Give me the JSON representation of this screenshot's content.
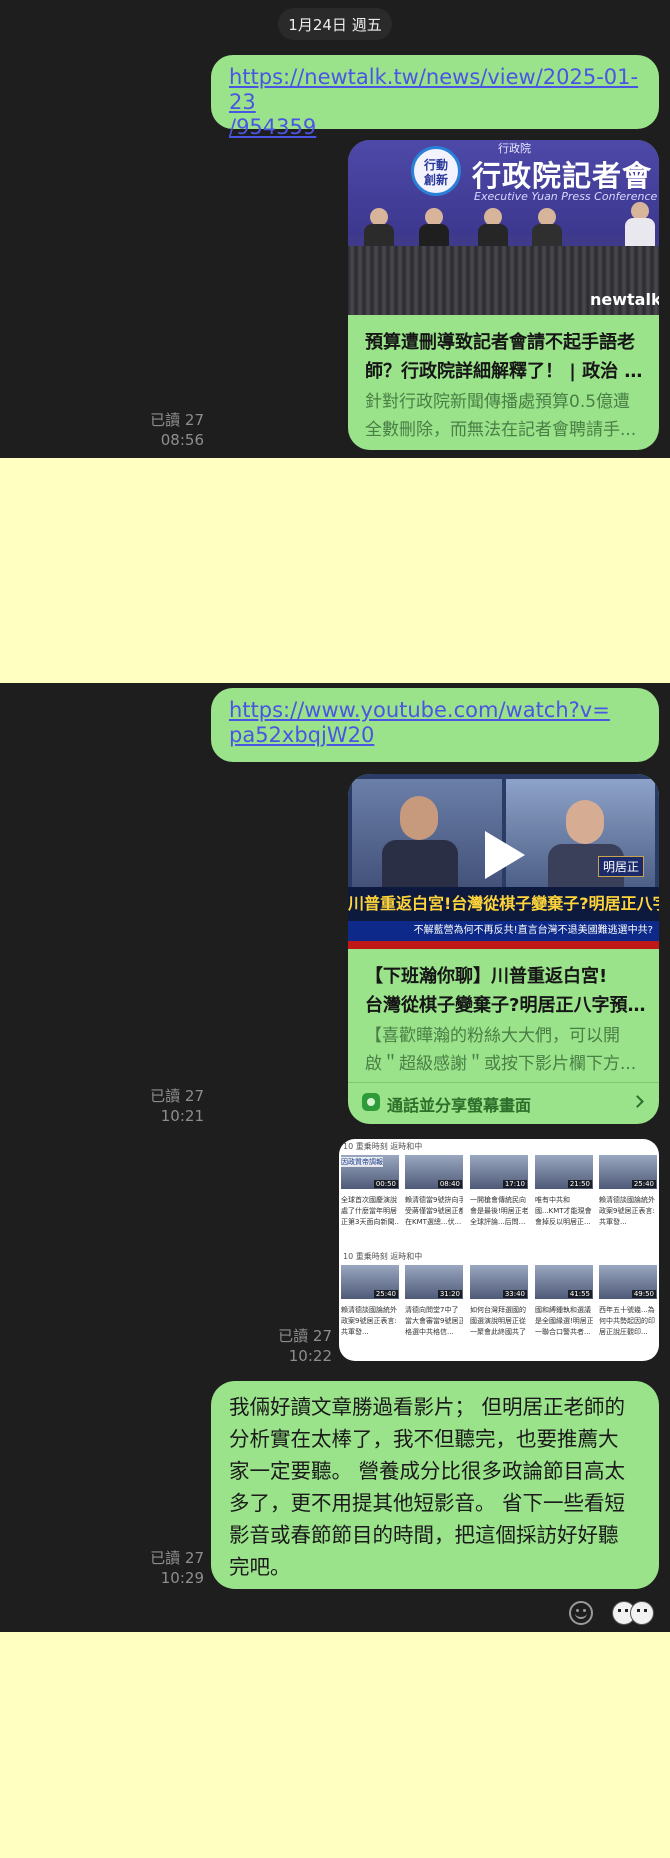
{
  "date_divider": "1月24日 週五",
  "messages": [
    {
      "link": [
        "https://newtalk.tw/news/view/2025-01-23",
        "/954359"
      ],
      "preview": {
        "banner_title": "行政院記者會",
        "banner_subtitle": "Executive Yuan Press Conference",
        "banner_logo": [
          "行動",
          "創新"
        ],
        "banner_header": "行政院",
        "watermark": "newtalk",
        "title": [
          "預算遭刪導致記者會請不起手語老",
          "師？行政院詳細解釋了！ | 政治 |..."
        ],
        "desc": [
          "針對行政院新聞傳播處預算0.5億遭",
          "全數刪除，而無法在記者會聘請手..."
        ]
      },
      "read": "已讀 27",
      "time": "08:56"
    },
    {
      "link": [
        "https://www.youtube.com/watch?v=",
        "pa52xbqjW20"
      ],
      "preview": {
        "thumb_caption": "川普重返白宮!台灣從棋子變棄子?明居正八字預言台灣命運!",
        "thumb_subcaption": "不解藍營為何不再反共!直言台灣不退美國難逃選中共?",
        "thumb_name": "明居正",
        "title": [
          "【下班瀚你聊】川普重返白宮!",
          "台灣從棋子變棄子?明居正八字預..."
        ],
        "desc": [
          "【喜歡瞱瀚的粉絲大大們，可以開",
          "啟＂超級感謝＂或按下影片欄下方..."
        ],
        "share_label": "通話並分享螢幕畫面"
      },
      "read": "已讀 27",
      "time": "10:21"
    },
    {
      "screenshot": {
        "rows": [
          {
            "header": "10 重乗時刻 返時和中",
            "items": [
              {
                "dur": "00:50",
                "text": [
                  "全球首次國慶演說",
                  "處了什麼當年明居",
                  "正第3天面向新聞..."
                ]
              },
              {
                "dur": "08:40",
                "text": [
                  "賴清德當9號拚向手",
                  "受蔣僅當9號居正都",
                  "在KMT選總...伏..."
                ]
              },
              {
                "dur": "17:10",
                "text": [
                  "一開槍會傳統民向",
                  "會是最後!明居正老",
                  "全球評論...后問..."
                ]
              },
              {
                "dur": "21:50",
                "text": [
                  "唯有中共和",
                  "國...KMT才能現會",
                  "會掉反以明居正..."
                ]
              },
              {
                "dur": "25:40",
                "text": [
                  "賴清德談國論統外",
                  "政案9號居正表言:",
                  "共軍發..."
                ]
              }
            ]
          },
          {
            "header": "10 重乗時刻 返時和中",
            "items": [
              {
                "dur": "25:40",
                "text": [
                  "賴清德談國論統外",
                  "政案9號居正表言:",
                  "共軍發..."
                ]
              },
              {
                "dur": "31:20",
                "text": [
                  "清德向問堂7中了",
                  "當大會審當9號居正",
                  "格選中共格信..."
                ]
              },
              {
                "dur": "33:40",
                "text": [
                  "如何台灣拜選國的",
                  "國選演說明居正從",
                  "一聚會此終國共了"
                ]
              },
              {
                "dur": "41:55",
                "text": [
                  "國和縛鍾執和選議",
                  "是全國緣選!明居正",
                  "一聯合口警共者..."
                ]
              },
              {
                "dur": "49:50",
                "text": [
                  "西年五十號幾...為",
                  "何中共勢起因的印",
                  "居正說圧觀印..."
                ]
              }
            ]
          }
        ],
        "video_label": "因政質帝調報"
      },
      "read": "已讀 27",
      "time": "10:22"
    },
    {
      "text": [
        "我倆好讀文章勝過看影片； 但明居正老師的",
        "分析實在太棒了，我不但聽完，也要推薦大",
        "家一定要聽。 營養成分比很多政論節目高太",
        "多了，更不用提其他短影音。 省下一些看短",
        "影音或春節節目的時間，把這個採訪好好聽",
        "完吧。"
      ],
      "read": "已讀 27",
      "time": "10:29"
    }
  ],
  "colors": {
    "chat_bg": "#1e1e1e",
    "bubble": "#9ae38a",
    "link": "#4a55e4",
    "page_bg": "#ffffc2",
    "meta": "#8e8e8e"
  },
  "icons": [
    "play-icon",
    "share-screen-icon",
    "chevron-right-icon",
    "emoji-icon",
    "reaction-faces-icon"
  ]
}
